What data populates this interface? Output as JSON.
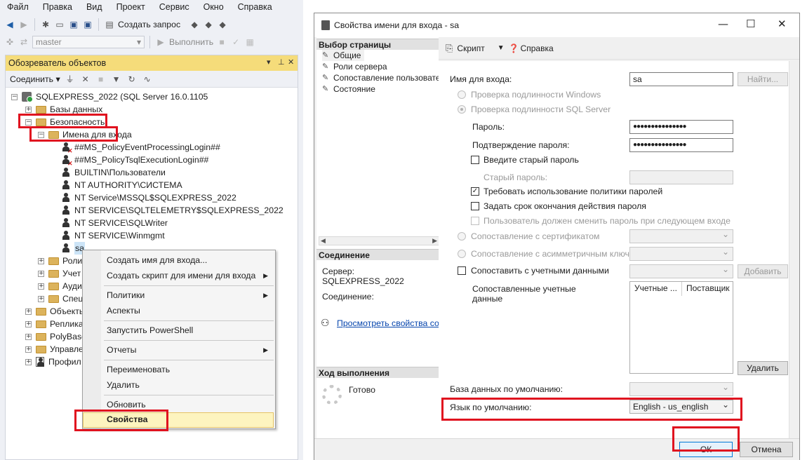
{
  "ssms": {
    "menu": [
      "Файл",
      "Правка",
      "Вид",
      "Проект",
      "Сервис",
      "Окно",
      "Справка"
    ],
    "toolbar": {
      "new_query": "Создать запрос",
      "execute": "Выполнить",
      "database": "master"
    },
    "object_explorer": {
      "title": "Обозреватель объектов",
      "connect_label": "Соединить",
      "tree": [
        {
          "label": "SQLEXPRESS_2022 (SQL Server 16.0.1105",
          "level": 0,
          "expander": "⊟",
          "icon": "server-icon"
        },
        {
          "label": "Базы данных",
          "level": 1,
          "expander": "⊞",
          "icon": "folder-icon"
        },
        {
          "label": "Безопасность",
          "level": 1,
          "expander": "⊟",
          "icon": "folder-icon"
        },
        {
          "label": "Имена для входа",
          "level": 2,
          "expander": "⊟",
          "icon": "folder-icon"
        },
        {
          "label": "##MS_PolicyEventProcessingLogin##",
          "level": 3,
          "icon": "login-disabled-icon"
        },
        {
          "label": "##MS_PolicyTsqlExecutionLogin##",
          "level": 3,
          "icon": "login-disabled-icon"
        },
        {
          "label": "BUILTIN\\Пользователи",
          "level": 3,
          "icon": "login-icon"
        },
        {
          "label": "NT AUTHORITY\\СИСТЕМА",
          "level": 3,
          "icon": "login-icon"
        },
        {
          "label": "NT Service\\MSSQL$SQLEXPRESS_2022",
          "level": 3,
          "icon": "login-icon"
        },
        {
          "label": "NT SERVICE\\SQLTELEMETRY$SQLEXPRESS_2022",
          "level": 3,
          "icon": "login-icon"
        },
        {
          "label": "NT SERVICE\\SQLWriter",
          "level": 3,
          "icon": "login-icon"
        },
        {
          "label": "NT SERVICE\\Winmgmt",
          "level": 3,
          "icon": "login-icon"
        },
        {
          "label": "sa",
          "level": 3,
          "icon": "login-icon",
          "selected": true
        },
        {
          "label": "Роли",
          "level": 2,
          "expander": "⊞",
          "icon": "folder-icon"
        },
        {
          "label": "Учет",
          "level": 2,
          "expander": "⊞",
          "icon": "folder-icon"
        },
        {
          "label": "Ауди",
          "level": 2,
          "expander": "⊞",
          "icon": "folder-icon"
        },
        {
          "label": "Спец",
          "level": 2,
          "expander": "⊞",
          "icon": "folder-icon"
        },
        {
          "label": "Объекты",
          "level": 1,
          "expander": "⊞",
          "icon": "folder-icon"
        },
        {
          "label": "Реплика",
          "level": 1,
          "expander": "⊞",
          "icon": "folder-icon"
        },
        {
          "label": "PolyBase",
          "level": 1,
          "expander": "⊞",
          "icon": "folder-icon"
        },
        {
          "label": "Управле",
          "level": 1,
          "expander": "⊞",
          "icon": "folder-icon"
        },
        {
          "label": "Профил",
          "level": 1,
          "expander": "⊞",
          "icon": "profiler-icon"
        }
      ]
    },
    "context_menu": {
      "new_login": "Создать имя для входа...",
      "script_login": "Создать скрипт для имени для входа",
      "policies": "Политики",
      "facets": "Аспекты",
      "powershell": "Запустить PowerShell",
      "reports": "Отчеты",
      "rename": "Переименовать",
      "delete": "Удалить",
      "refresh": "Обновить",
      "properties": "Свойства"
    }
  },
  "dialog": {
    "title": "Свойства имени для входа - sa",
    "select_page_header": "Выбор страницы",
    "pages": [
      "Общие",
      "Роли сервера",
      "Сопоставление пользовате",
      "Состояние"
    ],
    "connection_header": "Соединение",
    "server_label": "Сервер:",
    "server_value": "SQLEXPRESS_2022",
    "connection_label": "Соединение:",
    "view_link": "Просмотреть свойства соед",
    "progress_header": "Ход выполнения",
    "progress_status": "Готово",
    "toolbar": {
      "script": "Скрипт",
      "help": "Справка"
    },
    "form": {
      "login_name_label": "Имя для входа:",
      "login_name_value": "sa",
      "find_button": "Найти...",
      "windows_auth": "Проверка подлинности Windows",
      "sql_auth": "Проверка подлинности SQL Server",
      "password_label": "Пароль:",
      "password_value": "●●●●●●●●●●●●●●●",
      "confirm_label": "Подтверждение пароля:",
      "confirm_value": "●●●●●●●●●●●●●●●",
      "old_password_check": "Введите старый пароль",
      "old_password_label": "Старый пароль:",
      "enforce_policy": "Требовать использование политики паролей",
      "enforce_expiration": "Задать срок окончания действия пароля",
      "must_change": "Пользователь должен сменить пароль при следующем входе",
      "map_certificate": "Сопоставление с сертификатом",
      "map_asymmetric": "Сопоставление с асимметричным ключом",
      "map_credential": "Сопоставить с учетными данными",
      "add_button": "Добавить",
      "mapped_credentials_label": "Сопоставленные учетные данные",
      "grid_col1": "Учетные ...",
      "grid_col2": "Поставщик",
      "remove_button": "Удалить",
      "default_db_label": "База данных по умолчанию:",
      "default_lang_label": "Язык по умолчанию:",
      "default_lang_value": "English - us_english"
    },
    "ok_button": "ОК",
    "cancel_button": "Отмена"
  }
}
